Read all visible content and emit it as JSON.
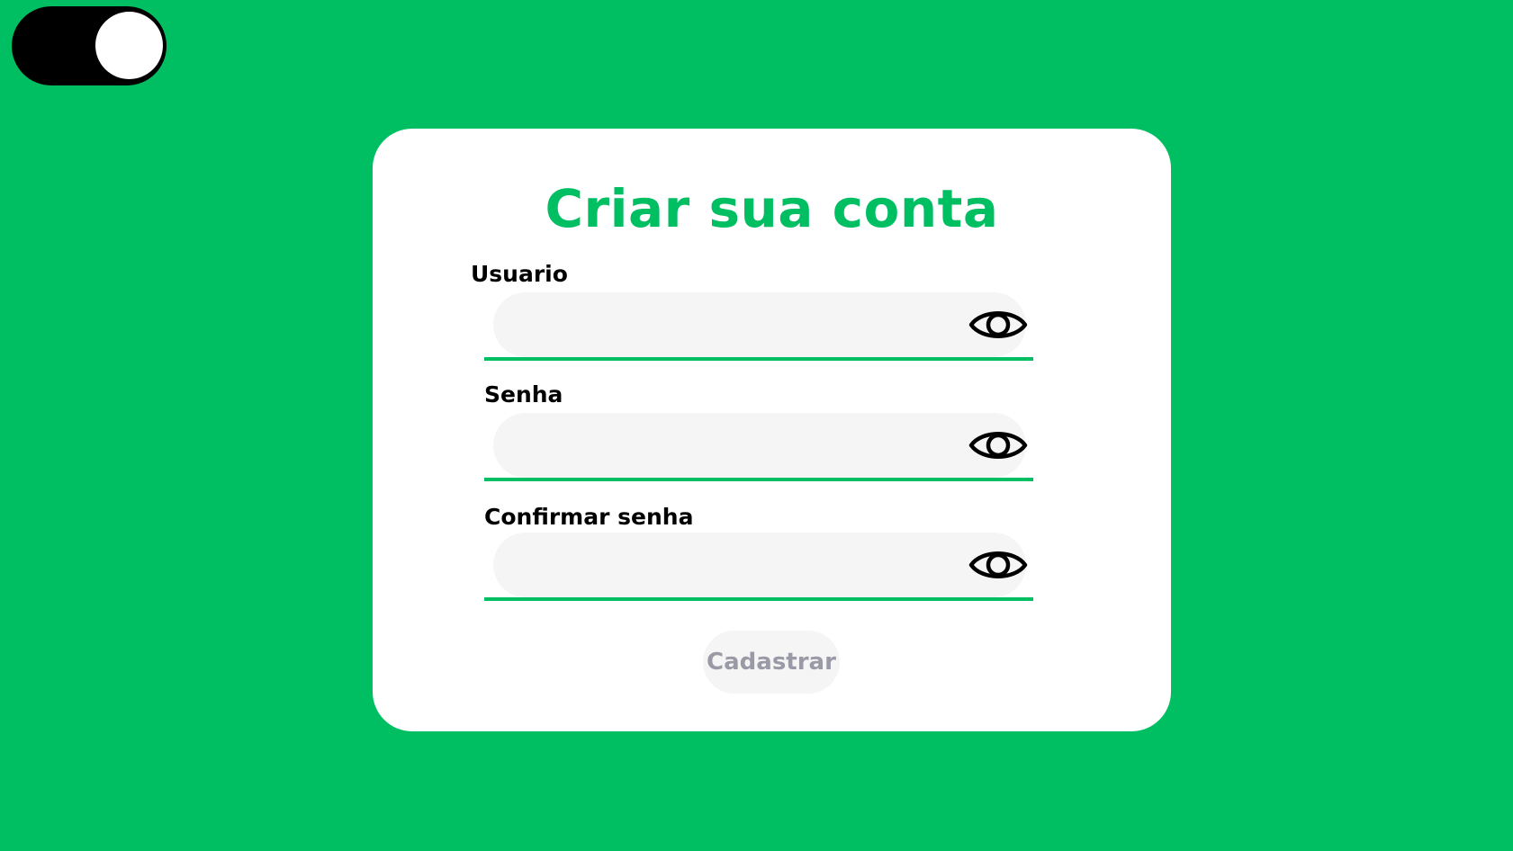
{
  "theme_toggle": {
    "state": "on"
  },
  "form": {
    "title": "Criar sua conta",
    "fields": [
      {
        "label": "Usuario",
        "value": "",
        "placeholder": "",
        "icon": "eye-icon"
      },
      {
        "label": "Senha",
        "value": "",
        "placeholder": "",
        "icon": "eye-icon"
      },
      {
        "label": "Confirmar senha",
        "value": "",
        "placeholder": "",
        "icon": "eye-icon"
      }
    ],
    "submit_label": "Cadastrar"
  },
  "colors": {
    "background": "#00bf63",
    "accent": "#00bf63",
    "card": "#ffffff",
    "field_fill": "#f5f5f5",
    "toggle_track": "#000000",
    "toggle_knob": "#ffffff",
    "button_text": "#9a9aa6"
  }
}
